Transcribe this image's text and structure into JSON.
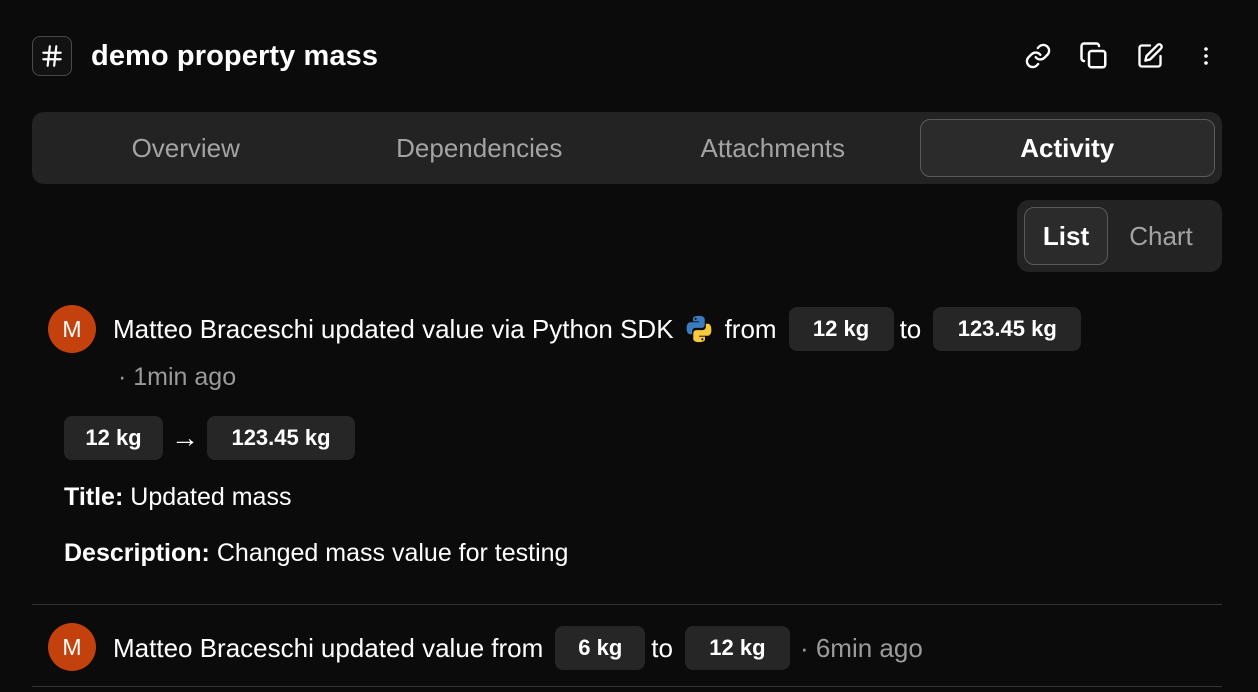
{
  "header": {
    "title": "demo property mass",
    "icons": [
      "hash-icon",
      "link-icon",
      "copy-icon",
      "edit-icon",
      "more-vertical-icon"
    ]
  },
  "tabs": [
    {
      "label": "Overview",
      "active": false
    },
    {
      "label": "Dependencies",
      "active": false
    },
    {
      "label": "Attachments",
      "active": false
    },
    {
      "label": "Activity",
      "active": true
    }
  ],
  "view_toggle": {
    "options": [
      {
        "label": "List",
        "active": true
      },
      {
        "label": "Chart",
        "active": false
      }
    ]
  },
  "activities": [
    {
      "avatar_initial": "M",
      "user": "Matteo Braceschi",
      "action": "updated value via Python SDK",
      "source_icon": "python-icon",
      "from_word": "from",
      "from_value": "12 kg",
      "to_word": "to",
      "to_value": "123.45 kg",
      "time": "· 1min ago",
      "change_from": "12 kg",
      "change_arrow": "→",
      "change_to": "123.45 kg",
      "title_label": "Title:",
      "title_value": "Updated mass",
      "description_label": "Description:",
      "description_value": "Changed mass value for testing"
    },
    {
      "avatar_initial": "M",
      "user": "Matteo Braceschi",
      "action": "updated value",
      "from_word": "from",
      "from_value": "6 kg",
      "to_word": "to",
      "to_value": "12 kg",
      "time": "· 6min ago"
    }
  ],
  "colors": {
    "background": "#0b0b0b",
    "panel": "#232323",
    "chip": "#262626",
    "avatar": "#c2410c",
    "muted_text": "#9a9a9a"
  }
}
